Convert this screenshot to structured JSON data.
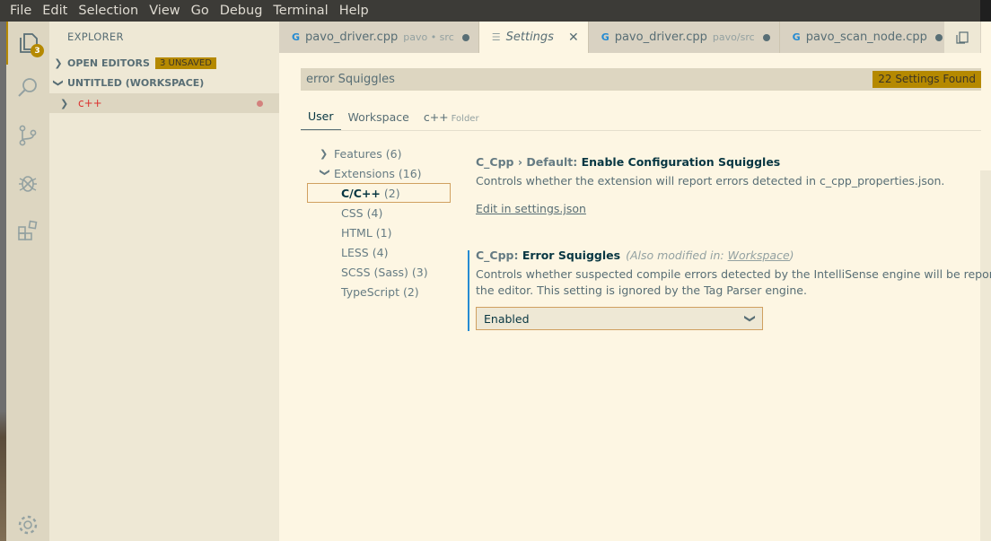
{
  "menubar": {
    "items": [
      "File",
      "Edit",
      "Selection",
      "View",
      "Go",
      "Debug",
      "Terminal",
      "Help"
    ]
  },
  "activitybar": {
    "explorer_badge": "3",
    "icons": [
      "files-icon",
      "search-icon",
      "source-control-icon",
      "debug-icon",
      "extensions-icon",
      "gear-icon"
    ]
  },
  "sidebar": {
    "title": "EXPLORER",
    "open_editors": {
      "label": "OPEN EDITORS",
      "badge": "3 UNSAVED"
    },
    "workspace": {
      "label": "UNTITLED (WORKSPACE)"
    },
    "tree_item": {
      "label": "c++"
    }
  },
  "tabs": [
    {
      "label": "pavo_driver.cpp",
      "desc": "pavo • src",
      "dirty": true,
      "active": false
    },
    {
      "label": "Settings",
      "desc": "",
      "dirty": false,
      "active": true
    },
    {
      "label": "pavo_driver.cpp",
      "desc": "pavo/src",
      "dirty": true,
      "active": false
    },
    {
      "label": "pavo_scan_node.cpp",
      "desc": "",
      "dirty": true,
      "active": false
    }
  ],
  "settings": {
    "search_value": "error Squiggles",
    "results_badge": "22 Settings Found",
    "scopes": {
      "user": "User",
      "workspace": "Workspace",
      "folder_name": "c++",
      "folder_sub": "Folder"
    },
    "toc": {
      "features": {
        "label": "Features",
        "count": "(6)"
      },
      "extensions": {
        "label": "Extensions",
        "count": "(16)"
      },
      "children": [
        {
          "label": "C/C++",
          "count": "(2)"
        },
        {
          "label": "CSS",
          "count": "(4)"
        },
        {
          "label": "HTML",
          "count": "(1)"
        },
        {
          "label": "LESS",
          "count": "(4)"
        },
        {
          "label": "SCSS (Sass)",
          "count": "(3)"
        },
        {
          "label": "TypeScript",
          "count": "(2)"
        }
      ]
    },
    "item1": {
      "category": "C_Cpp › Default: ",
      "name": "Enable Configuration Squiggles",
      "description": "Controls whether the extension will report errors detected in c_cpp_properties.json.",
      "link": "Edit in settings.json"
    },
    "item2": {
      "category": "C_Cpp: ",
      "name": "Error Squiggles",
      "modified_prefix": "(Also modified in: ",
      "modified_link": "Workspace",
      "modified_suffix": ")",
      "description_line1": "Controls whether suspected compile errors detected by the IntelliSense engine will be reported to",
      "description_line2": "the editor. This setting is ignored by the Tag Parser engine.",
      "value": "Enabled"
    }
  },
  "colors": {
    "accent": "#b58900",
    "background": "#fdf6e3",
    "sidebar": "#eee8d5",
    "modified_bar": "#268bd2",
    "error_red": "#dc322f"
  }
}
